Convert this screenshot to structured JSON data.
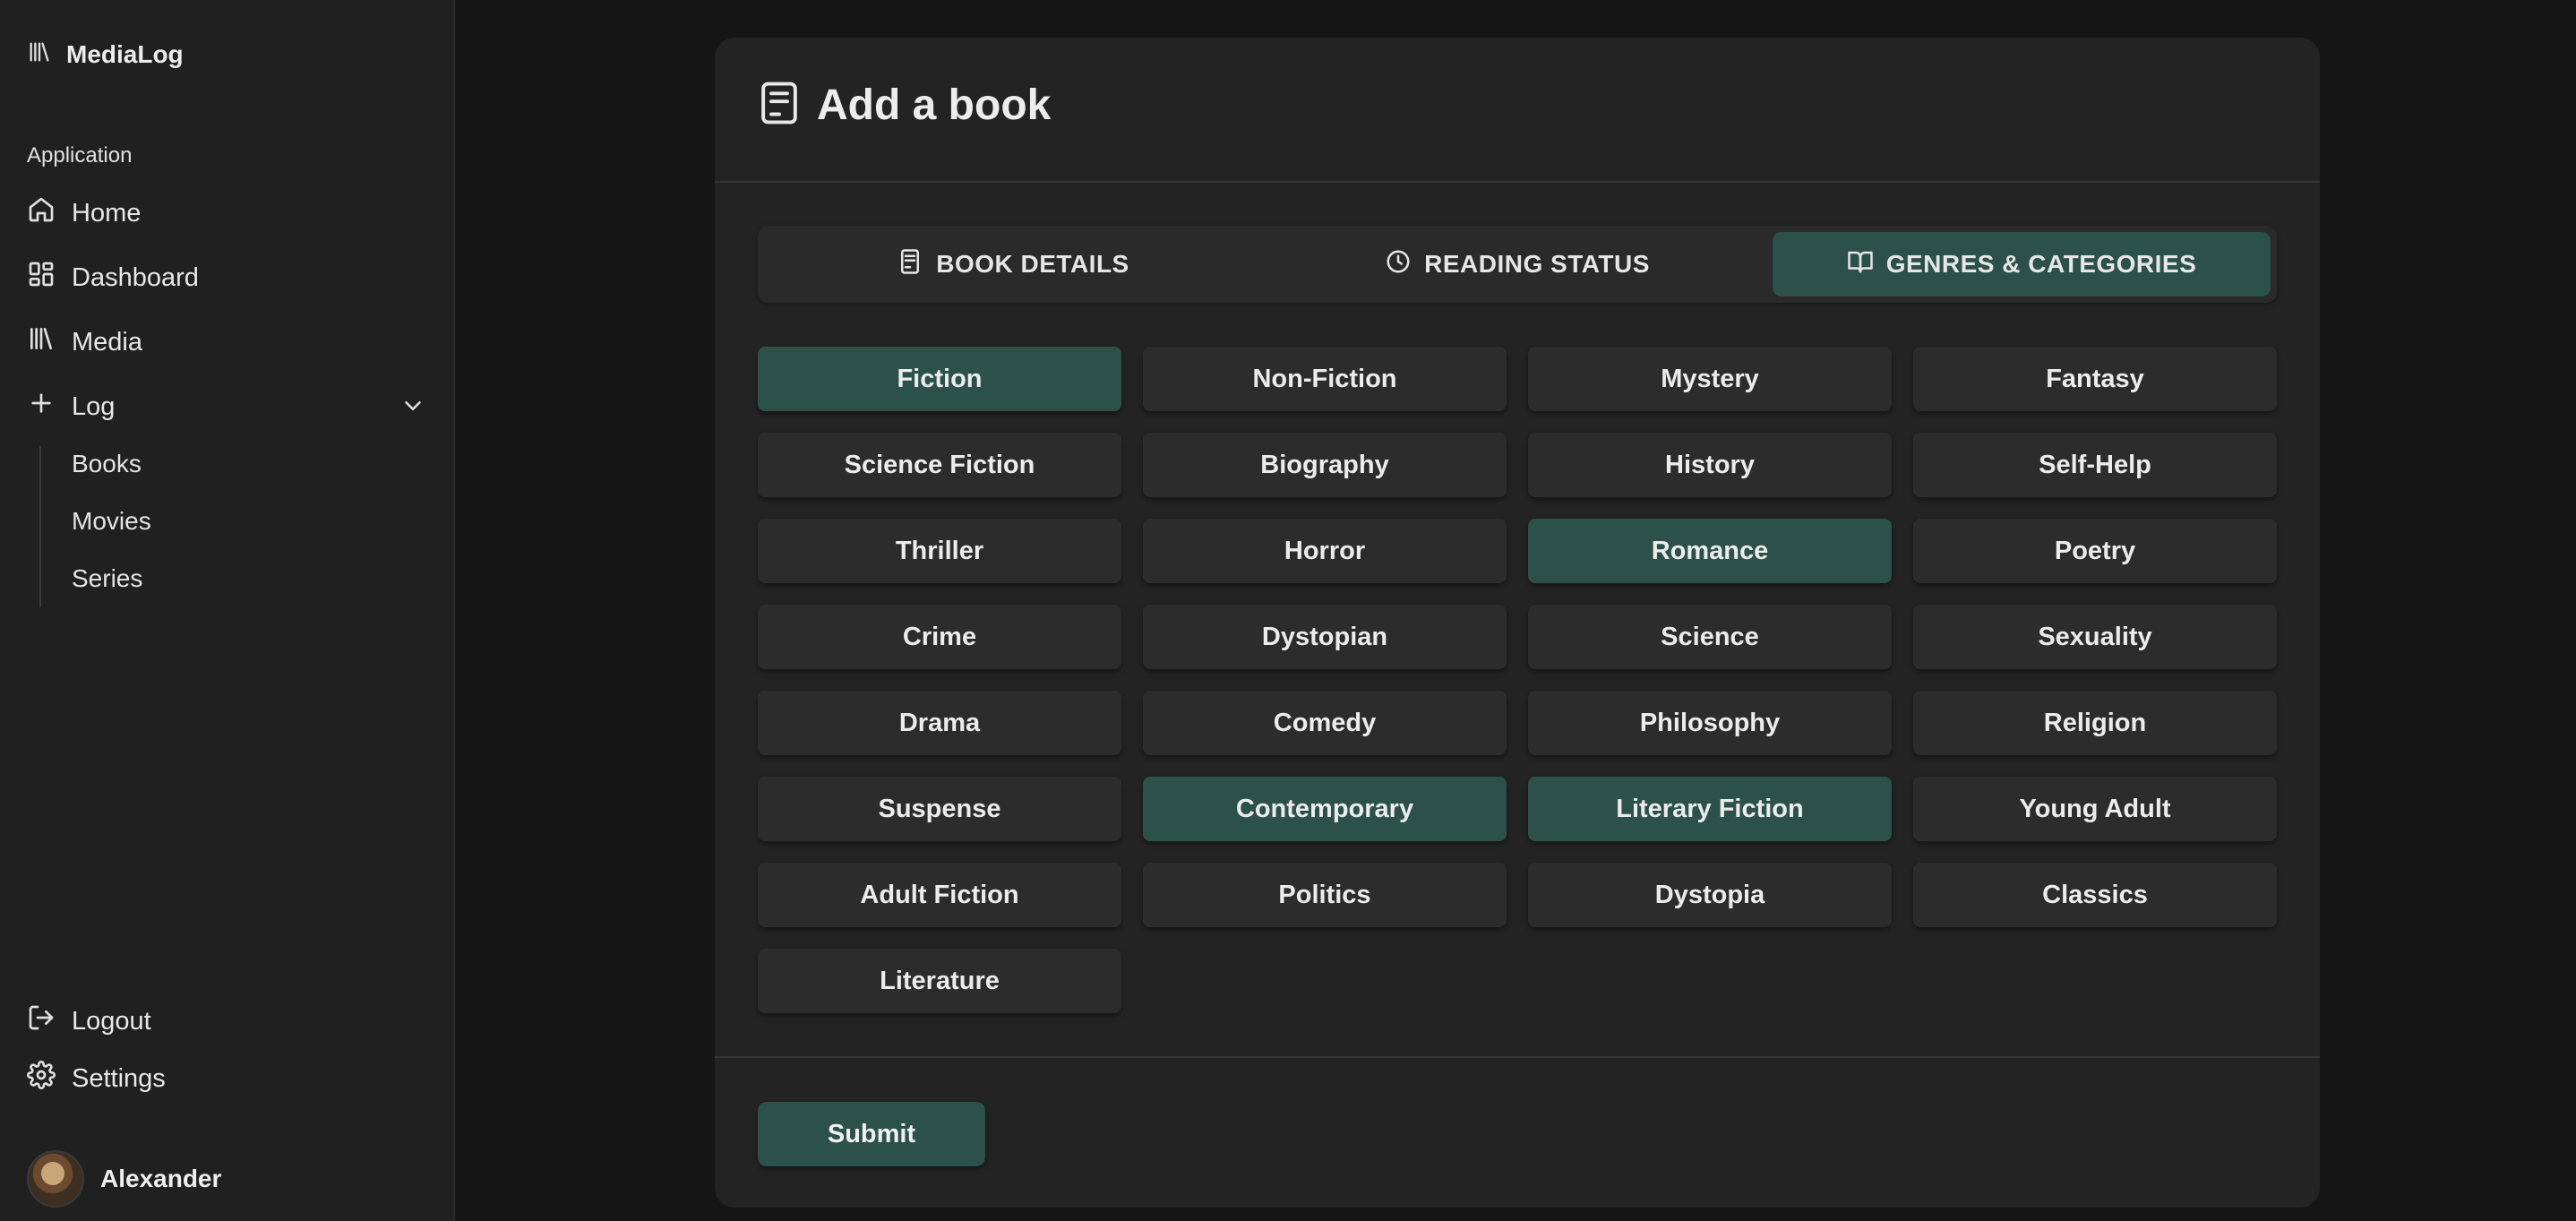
{
  "app": {
    "name": "MediaLog"
  },
  "sidebar": {
    "section_label": "Application",
    "items": [
      {
        "label": "Home",
        "icon": "home-icon"
      },
      {
        "label": "Dashboard",
        "icon": "dashboard-icon"
      },
      {
        "label": "Media",
        "icon": "library-icon"
      },
      {
        "label": "Log",
        "icon": "plus-icon",
        "expanded": true
      }
    ],
    "log_subitems": [
      "Books",
      "Movies",
      "Series"
    ],
    "bottom": [
      {
        "label": "Logout",
        "icon": "logout-icon"
      },
      {
        "label": "Settings",
        "icon": "gear-icon"
      }
    ],
    "user": {
      "name": "Alexander"
    }
  },
  "card": {
    "title": "Add a book",
    "tabs": [
      {
        "label": "BOOK DETAILS",
        "icon": "document-icon",
        "active": false
      },
      {
        "label": "READING STATUS",
        "icon": "clock-icon",
        "active": false
      },
      {
        "label": "GENRES & CATEGORIES",
        "icon": "open-book-icon",
        "active": true
      }
    ],
    "genres": [
      {
        "label": "Fiction",
        "selected": true
      },
      {
        "label": "Non-Fiction",
        "selected": false
      },
      {
        "label": "Mystery",
        "selected": false
      },
      {
        "label": "Fantasy",
        "selected": false
      },
      {
        "label": "Science Fiction",
        "selected": false
      },
      {
        "label": "Biography",
        "selected": false
      },
      {
        "label": "History",
        "selected": false
      },
      {
        "label": "Self-Help",
        "selected": false
      },
      {
        "label": "Thriller",
        "selected": false
      },
      {
        "label": "Horror",
        "selected": false
      },
      {
        "label": "Romance",
        "selected": true
      },
      {
        "label": "Poetry",
        "selected": false
      },
      {
        "label": "Crime",
        "selected": false
      },
      {
        "label": "Dystopian",
        "selected": false
      },
      {
        "label": "Science",
        "selected": false
      },
      {
        "label": "Sexuality",
        "selected": false
      },
      {
        "label": "Drama",
        "selected": false
      },
      {
        "label": "Comedy",
        "selected": false
      },
      {
        "label": "Philosophy",
        "selected": false
      },
      {
        "label": "Religion",
        "selected": false
      },
      {
        "label": "Suspense",
        "selected": false
      },
      {
        "label": "Contemporary",
        "selected": true
      },
      {
        "label": "Literary Fiction",
        "selected": true
      },
      {
        "label": "Young Adult",
        "selected": false
      },
      {
        "label": "Adult Fiction",
        "selected": false
      },
      {
        "label": "Politics",
        "selected": false
      },
      {
        "label": "Dystopia",
        "selected": false
      },
      {
        "label": "Classics",
        "selected": false
      },
      {
        "label": "Literature",
        "selected": false
      }
    ],
    "submit_label": "Submit"
  },
  "colors": {
    "accent": "#2b5148",
    "page_bg": "#151515",
    "sidebar_bg": "#202020",
    "card_bg": "#232323",
    "chip_bg": "#2c2c2c"
  }
}
